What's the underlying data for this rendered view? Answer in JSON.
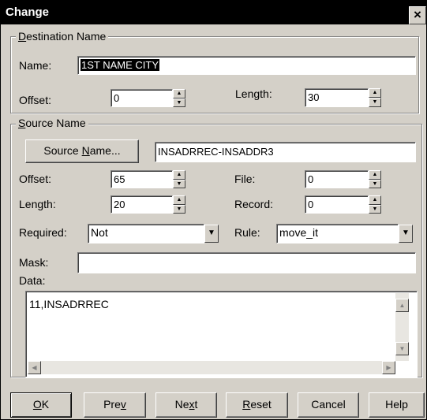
{
  "window": {
    "title": "Change",
    "close_glyph": "×"
  },
  "destination": {
    "legend_accel": "D",
    "legend_rest": "estination Name",
    "name_label": "Name:",
    "name_value": "1ST NAME CITY",
    "offset_label": "Offset:",
    "offset_value": "0",
    "length_label": "Length:",
    "length_value": "30"
  },
  "source": {
    "legend_accel": "S",
    "legend_rest": "ource Name",
    "button_pre": "Source ",
    "button_accel": "N",
    "button_post": "ame...",
    "name_value": "INSADRREC-INSADDR3",
    "offset_label": "Offset:",
    "offset_value": "65",
    "file_label": "File:",
    "file_value": "0",
    "length_label": "Length:",
    "length_value": "20",
    "record_label": "Record:",
    "record_value": "0",
    "required_label": "Required:",
    "required_value": "Not",
    "rule_label": "Rule:",
    "rule_value": "move_it",
    "mask_label": "Mask:",
    "mask_value": "",
    "data_label": "Data:",
    "data_value": "11,INSADRREC"
  },
  "buttons": {
    "ok_accel": "O",
    "ok_rest": "K",
    "prev_pre": "Pre",
    "prev_accel": "v",
    "next_pre": "Ne",
    "next_accel": "x",
    "next_post": "t",
    "reset_accel": "R",
    "reset_rest": "eset",
    "cancel": "Cancel",
    "help": "Help"
  }
}
